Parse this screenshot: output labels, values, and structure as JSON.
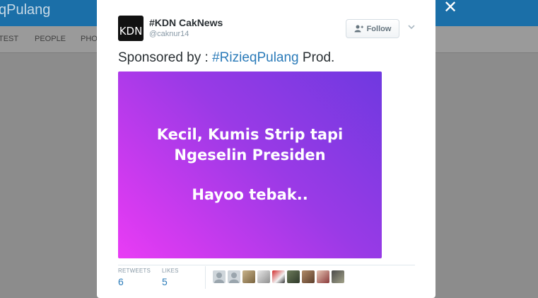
{
  "background": {
    "title_fragment": "qPulang",
    "tabs": [
      "TEST",
      "PEOPLE",
      "PHO"
    ],
    "close_glyph": "✕"
  },
  "tweet": {
    "avatar_text": "KDN",
    "display_name": "#KDN CakNews",
    "screen_name": "@caknur14",
    "follow_label": "Follow",
    "text_prefix": "Sponsored by : ",
    "hashtag": "#RizieqPulang",
    "text_suffix": " Prod.",
    "media": {
      "line1": "Kecil, Kumis Strip tapi",
      "line2": "Ngeselin Presiden",
      "line3": "Hayoo tebak.."
    },
    "stats": {
      "retweets_label": "RETWEETS",
      "retweets_value": "6",
      "likes_label": "LIKES",
      "likes_value": "5"
    },
    "liker_avatars": [
      "default-avatar",
      "default-avatar",
      "photo-avatar",
      "photo-avatar",
      "photo-avatar",
      "photo-avatar",
      "photo-avatar",
      "photo-avatar",
      "photo-avatar"
    ]
  },
  "colors": {
    "link": "#2b7bb9",
    "header_bar": "#1b6fa8",
    "overlay": "#8c8c8c"
  }
}
